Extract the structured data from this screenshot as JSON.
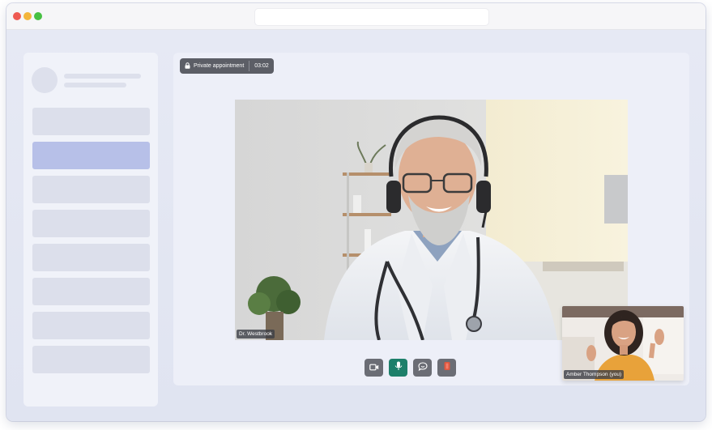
{
  "window": {
    "traffic_lights": [
      "close",
      "minimize",
      "zoom"
    ],
    "address_bar": ""
  },
  "sidebar": {
    "items": [
      {
        "state": "default"
      },
      {
        "state": "active"
      },
      {
        "state": "default"
      },
      {
        "state": "default"
      },
      {
        "state": "default"
      },
      {
        "state": "default"
      },
      {
        "state": "default"
      },
      {
        "state": "default"
      }
    ]
  },
  "call": {
    "badge_label": "Private appointment",
    "timer": "03:02",
    "remote_participant": "Dr. Westbrook",
    "local_participant": "Amber Thompson (you)"
  },
  "controls": {
    "camera": "camera-icon",
    "microphone": "microphone-icon",
    "chat": "chat-icon",
    "end_call": "end-call-icon"
  },
  "colors": {
    "active_nav": "#b7c0e8",
    "mic_active": "#1d7f6a",
    "control": "#6b6d75",
    "end_call": "#e0573f"
  }
}
